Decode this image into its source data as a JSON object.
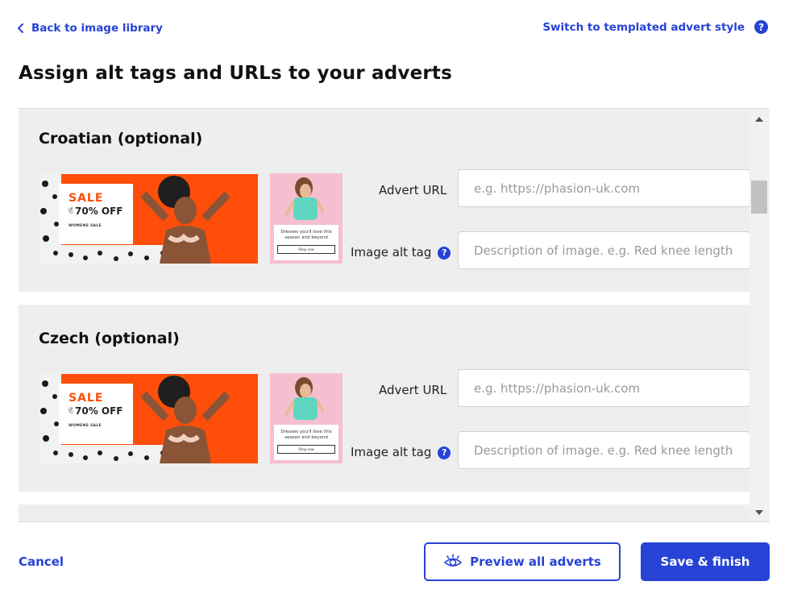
{
  "nav": {
    "back_label": "Back to image library",
    "switch_label": "Switch to templated advert style",
    "help_glyph": "?"
  },
  "page_title": "Assign alt tags and URLs to your adverts",
  "languages": [
    {
      "title": "Croatian (optional)",
      "advert_url_label": "Advert URL",
      "advert_url_value": "",
      "advert_url_placeholder": "e.g. https://phasion-uk.com",
      "alt_tag_label": "Image alt tag",
      "alt_tag_value": "",
      "alt_tag_placeholder": "Description of image. e.g. Red knee length s",
      "banner": {
        "sale": "SALE",
        "pct_prefix": "UP TO",
        "pct": "70% OFF",
        "tag": "WOMENS SALE"
      },
      "square": {
        "caption": "Dresses you'll love this season and beyond",
        "cta": "Shop now"
      }
    },
    {
      "title": "Czech (optional)",
      "advert_url_label": "Advert URL",
      "advert_url_value": "",
      "advert_url_placeholder": "e.g. https://phasion-uk.com",
      "alt_tag_label": "Image alt tag",
      "alt_tag_value": "",
      "alt_tag_placeholder": "Description of image. e.g. Red knee length s",
      "banner": {
        "sale": "SALE",
        "pct_prefix": "UP TO",
        "pct": "70% OFF",
        "tag": "WOMENS SALE"
      },
      "square": {
        "caption": "Dresses you'll love this season and beyond",
        "cta": "Shop now"
      }
    }
  ],
  "footer": {
    "cancel_label": "Cancel",
    "preview_label": "Preview all adverts",
    "save_label": "Save & finish"
  },
  "colors": {
    "accent": "#2743d6",
    "panel_bg": "#eeeeee",
    "banner_orange": "#ff4d0a",
    "square_pink": "#f5bfd0"
  },
  "icons": {
    "back": "chevron-left-icon",
    "help": "question-circle-icon",
    "preview": "eye-icon",
    "scroll_up": "scroll-up-arrow-icon",
    "scroll_down": "scroll-down-arrow-icon"
  }
}
